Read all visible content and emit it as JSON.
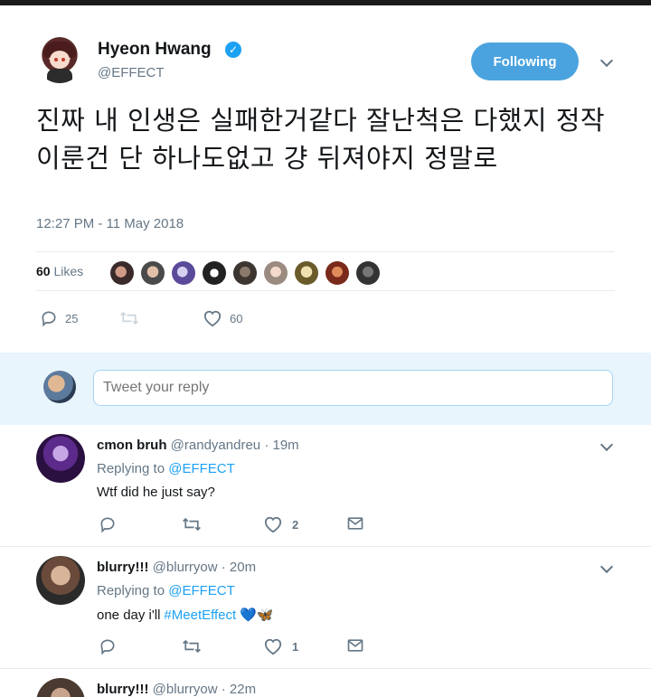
{
  "main_tweet": {
    "author_name": "Hyeon Hwang",
    "author_handle": "@EFFECT",
    "follow_label": "Following",
    "text": "진짜 내 인생은 실패한거같다 잘난척은 다했지 정작 이룬건 단 하나도없고 걍 뒤져야지 정말로",
    "timestamp": "12:27 PM - 11 May 2018",
    "likes_count": "60",
    "likes_label": "Likes",
    "reply_count": "25",
    "like_count": "60"
  },
  "reply_box": {
    "placeholder": "Tweet your reply"
  },
  "replies": [
    {
      "name": "cmon bruh",
      "handle": "@randyandreu",
      "time": "· 19m",
      "replying_label": "Replying to",
      "replying_to": "@EFFECT",
      "text": "Wtf did he just say?",
      "hashtag": "",
      "emoji": "",
      "like_count": "2"
    },
    {
      "name": "blurry!!!",
      "handle": "@blurryow",
      "time": "· 20m",
      "replying_label": "Replying to",
      "replying_to": "@EFFECT",
      "text": "one day i'll",
      "hashtag": "#MeetEffect",
      "emoji": "💙🦋",
      "like_count": "1"
    },
    {
      "name": "blurry!!!",
      "handle": "@blurryow",
      "time": "· 22m"
    }
  ],
  "colors": {
    "accent": "#1da1f2",
    "follow_button": "#4aa3df",
    "reply_box_bg": "#e8f5fd",
    "secondary_text": "#657786"
  },
  "icons": [
    "verified-badge-icon",
    "chevron-down-icon",
    "reply-icon",
    "retweet-icon",
    "like-icon",
    "direct-message-icon"
  ]
}
